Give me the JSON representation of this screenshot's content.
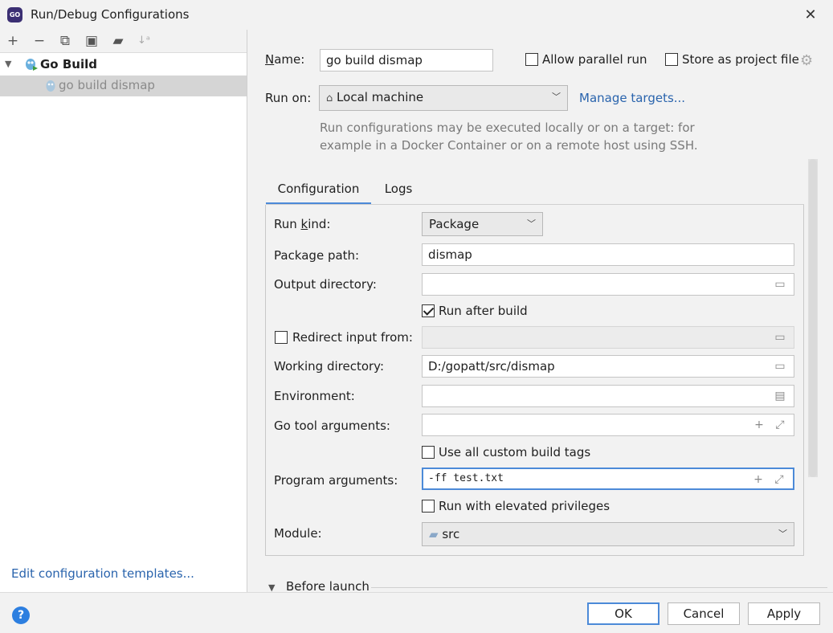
{
  "window": {
    "title": "Run/Debug Configurations",
    "close_glyph": "✕",
    "app_icon_text": "GO"
  },
  "left_toolbar": {
    "icons": [
      "add-icon",
      "remove-icon",
      "copy-icon",
      "save-icon",
      "new-folder-icon",
      "sort-icon"
    ],
    "add_glyph": "+",
    "remove_glyph": "−",
    "copy_glyph": "⧉",
    "save_glyph": "▣",
    "folder_glyph": "▰",
    "sort_glyph": "↓ᵃ"
  },
  "tree": {
    "root_label": "Go Build",
    "child_label": "go build dismap",
    "expander_glyph": "▼"
  },
  "templates_link": "Edit configuration templates...",
  "form": {
    "name_label": "Name:",
    "name_value": "go build dismap",
    "allow_parallel_label": "Allow parallel run",
    "allow_parallel_checked": false,
    "store_project_label": "Store as project file",
    "store_project_checked": false,
    "run_on_label": "Run on:",
    "run_on_value": "Local machine",
    "manage_targets": "Manage targets...",
    "desc_line1": "Run configurations may be executed locally or on a target: for",
    "desc_line2": "example in a Docker Container or on a remote host using SSH."
  },
  "tabs": [
    "Configuration",
    "Logs"
  ],
  "config": {
    "run_kind_label": "Run kind:",
    "run_kind_value": "Package",
    "package_path_label": "Package path:",
    "package_path_value": "dismap",
    "output_dir_label": "Output directory:",
    "output_dir_value": "",
    "run_after_build_label": "Run after build",
    "run_after_build_checked": true,
    "redirect_input_label": "Redirect input from:",
    "redirect_input_checked": false,
    "working_dir_label": "Working directory:",
    "working_dir_value": "D:/gopatt/src/dismap",
    "environment_label": "Environment:",
    "environment_value": "",
    "go_tool_args_label": "Go tool arguments:",
    "go_tool_args_value": "",
    "use_custom_tags_label": "Use all custom build tags",
    "use_custom_tags_checked": false,
    "program_args_label": "Program arguments:",
    "program_args_value": "-ff test.txt",
    "elevated_label": "Run with elevated privileges",
    "elevated_checked": false,
    "module_label": "Module:",
    "module_value": "src"
  },
  "before_launch": "Before launch",
  "buttons": {
    "ok": "OK",
    "cancel": "Cancel",
    "apply": "Apply",
    "help": "?"
  }
}
